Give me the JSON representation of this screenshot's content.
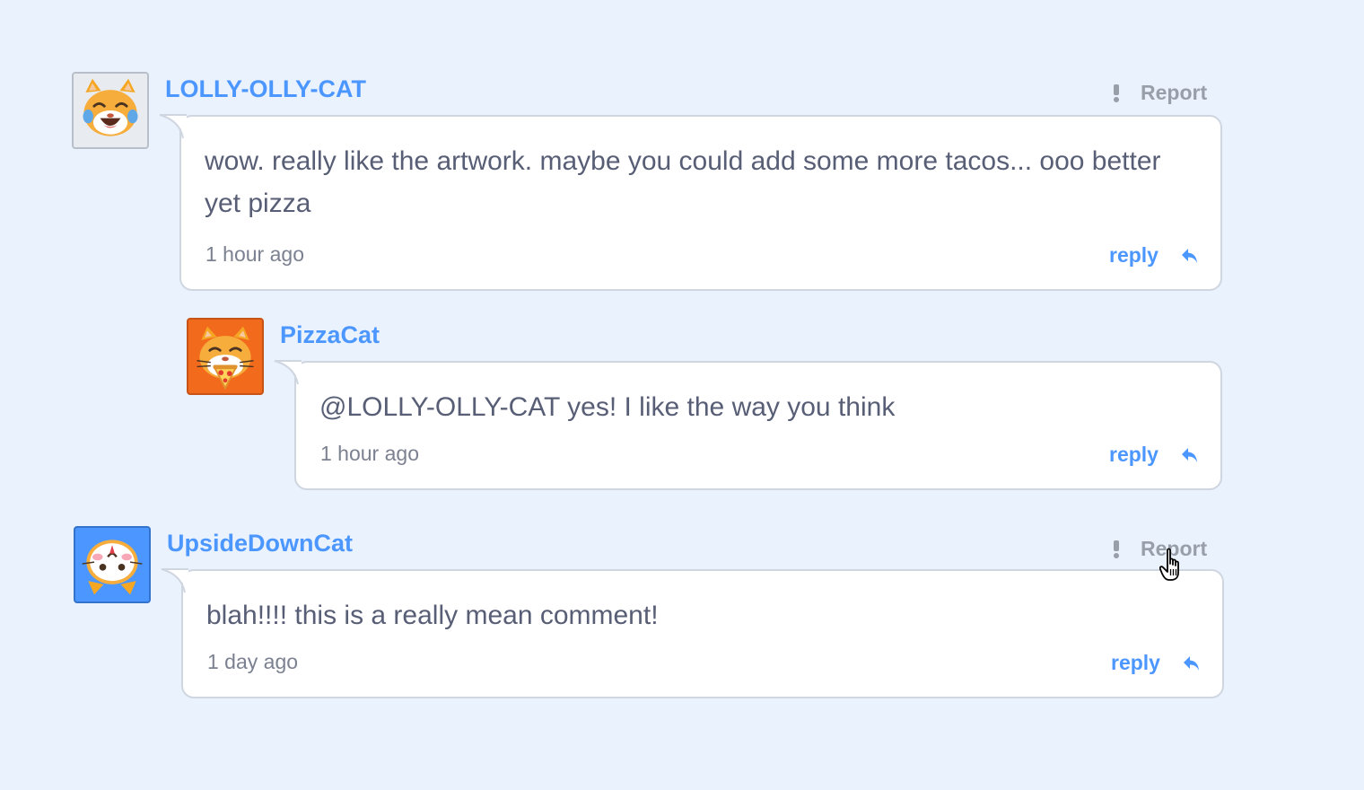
{
  "comments": [
    {
      "username": "LOLLY-OLLY-CAT",
      "text": "wow. really like the artwork. maybe you could add some more tacos... ooo better yet pizza",
      "timestamp": "1 hour ago",
      "reply_label": "reply",
      "report_label": "Report",
      "avatar_icon": "laughing-cat-emoji-icon",
      "avatar_bg": "#e8ecf1"
    },
    {
      "username": "PizzaCat",
      "text": "@LOLLY-OLLY-CAT yes! I like the way you think",
      "timestamp": "1 hour ago",
      "reply_label": "reply",
      "avatar_icon": "pizza-cat-emoji-icon",
      "avatar_bg": "#f26b1d"
    },
    {
      "username": "UpsideDownCat",
      "text": "blah!!!! this is a really mean comment!",
      "timestamp": "1 day ago",
      "reply_label": "reply",
      "report_label": "Report",
      "avatar_icon": "upside-down-cat-emoji-icon",
      "avatar_bg": "#4c97ff"
    }
  ],
  "colors": {
    "accent": "#4c97ff",
    "background": "#eaf2fe",
    "text": "#575e75",
    "muted": "#999fa9"
  },
  "icons": {
    "report": "exclamation-icon",
    "reply": "reply-arrow-icon",
    "cursor": "hand-pointer-cursor-icon"
  }
}
